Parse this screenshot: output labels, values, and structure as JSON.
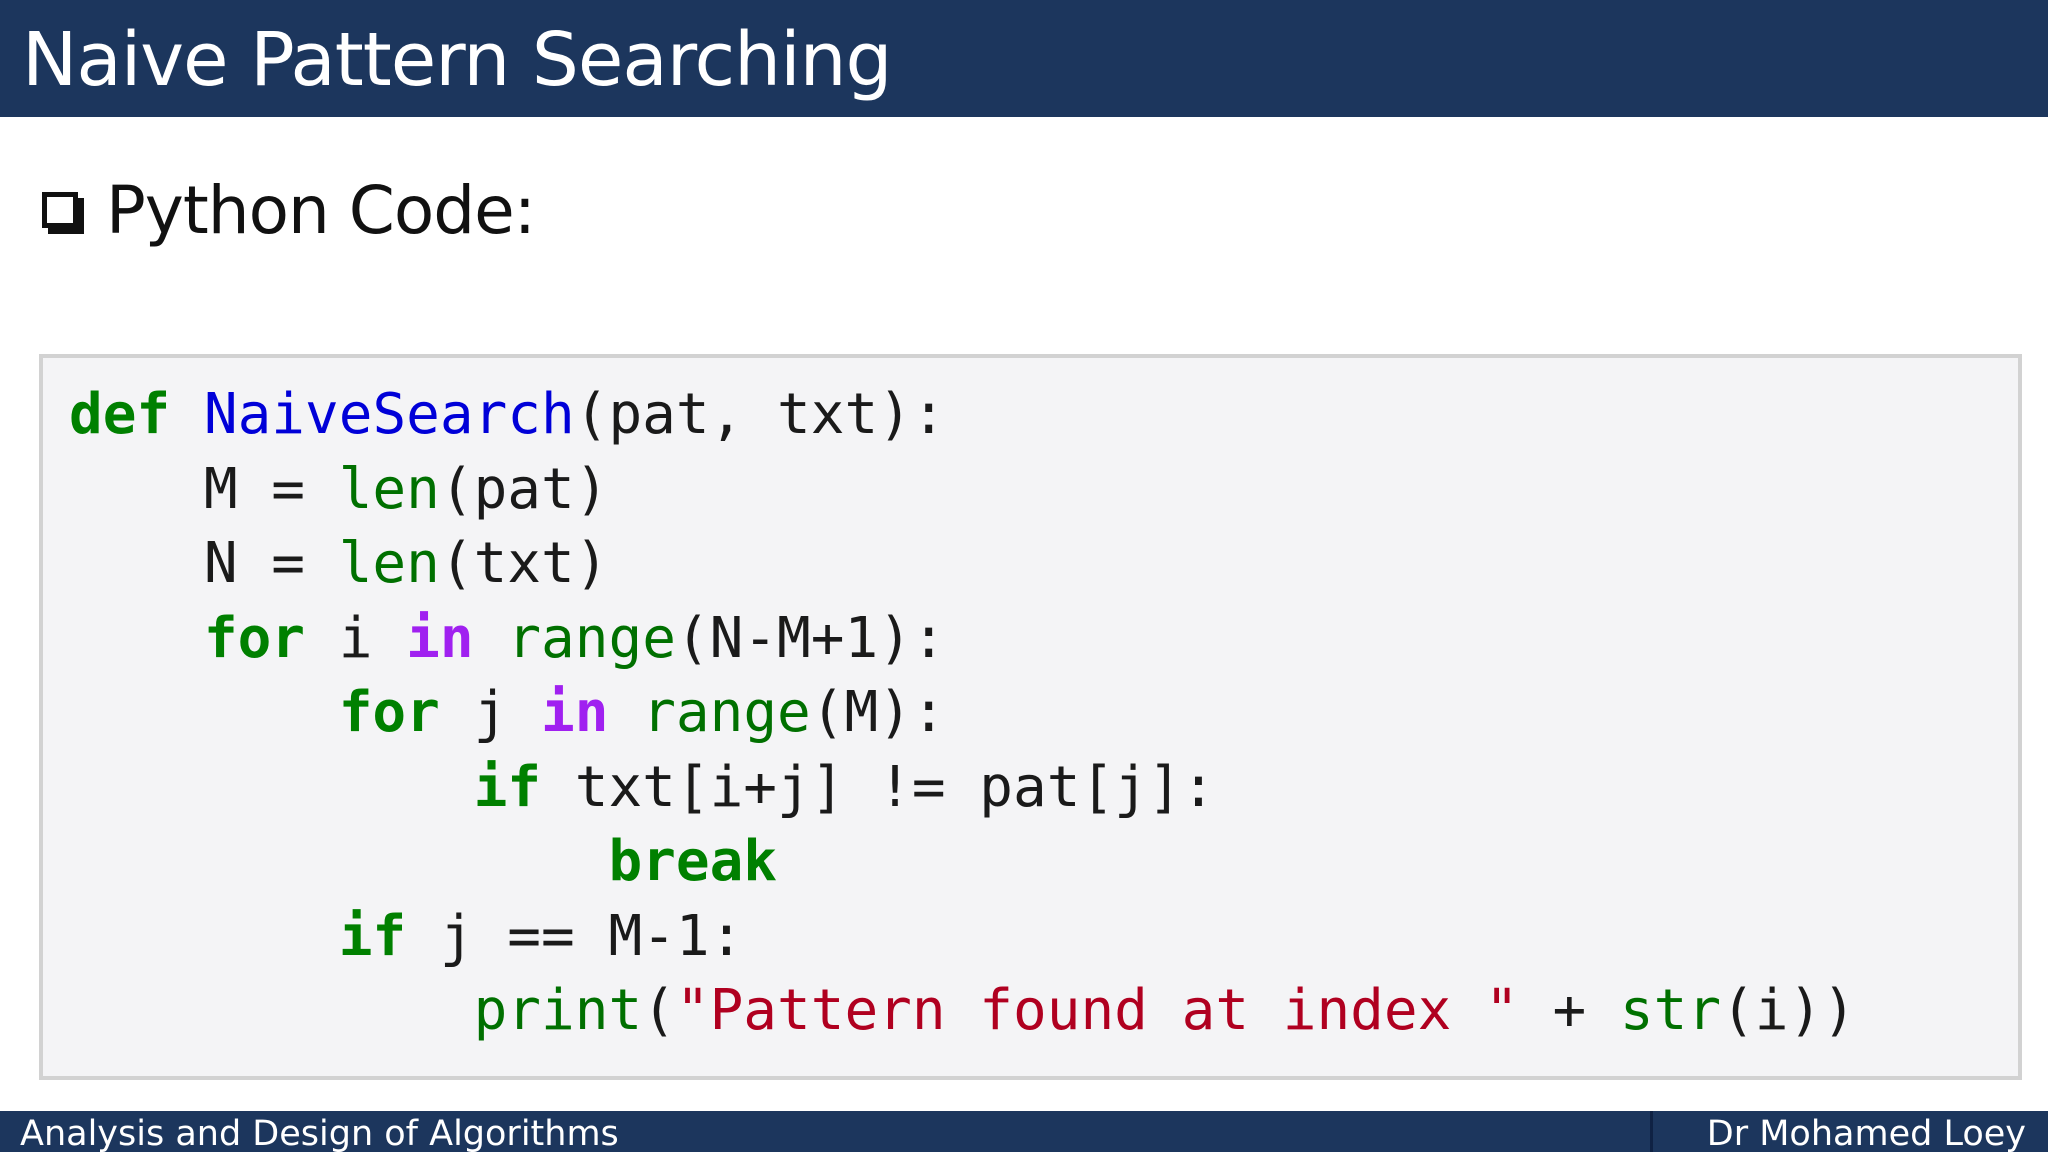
{
  "header": {
    "title": "Naive Pattern Searching"
  },
  "content": {
    "bullet": "Python Code:"
  },
  "code": {
    "lines": [
      [
        {
          "t": "kw",
          "v": "def"
        },
        {
          "t": "",
          "v": " "
        },
        {
          "t": "fn",
          "v": "NaiveSearch"
        },
        {
          "t": "",
          "v": "(pat, txt):"
        }
      ],
      [
        {
          "t": "",
          "v": "    M = "
        },
        {
          "t": "bi",
          "v": "len"
        },
        {
          "t": "",
          "v": "(pat)"
        }
      ],
      [
        {
          "t": "",
          "v": "    N = "
        },
        {
          "t": "bi",
          "v": "len"
        },
        {
          "t": "",
          "v": "(txt)"
        }
      ],
      [
        {
          "t": "",
          "v": "    "
        },
        {
          "t": "kw",
          "v": "for"
        },
        {
          "t": "",
          "v": " i "
        },
        {
          "t": "kw-in",
          "v": "in"
        },
        {
          "t": "",
          "v": " "
        },
        {
          "t": "bi",
          "v": "range"
        },
        {
          "t": "",
          "v": "(N-M+1):"
        }
      ],
      [
        {
          "t": "",
          "v": "        "
        },
        {
          "t": "kw",
          "v": "for"
        },
        {
          "t": "",
          "v": " j "
        },
        {
          "t": "kw-in",
          "v": "in"
        },
        {
          "t": "",
          "v": " "
        },
        {
          "t": "bi",
          "v": "range"
        },
        {
          "t": "",
          "v": "(M):"
        }
      ],
      [
        {
          "t": "",
          "v": "            "
        },
        {
          "t": "kw",
          "v": "if"
        },
        {
          "t": "",
          "v": " txt[i+j] != pat[j]:"
        }
      ],
      [
        {
          "t": "",
          "v": "                "
        },
        {
          "t": "kw",
          "v": "break"
        }
      ],
      [
        {
          "t": "",
          "v": "        "
        },
        {
          "t": "kw",
          "v": "if"
        },
        {
          "t": "",
          "v": " j == M-1:"
        }
      ],
      [
        {
          "t": "",
          "v": "            "
        },
        {
          "t": "bi",
          "v": "print"
        },
        {
          "t": "",
          "v": "("
        },
        {
          "t": "str",
          "v": "\"Pattern found at index \""
        },
        {
          "t": "",
          "v": " + "
        },
        {
          "t": "bi",
          "v": "str"
        },
        {
          "t": "",
          "v": "(i))"
        }
      ]
    ]
  },
  "footer": {
    "left": "Analysis and Design of Algorithms",
    "right": "Dr Mohamed Loey"
  },
  "colors": {
    "bar": "#1c365d",
    "keyword": "#008000",
    "keyword_in": "#a020f0",
    "function_name": "#0000d8",
    "builtin": "#007000",
    "string": "#b00020",
    "code_background": "#f4f4f6"
  }
}
